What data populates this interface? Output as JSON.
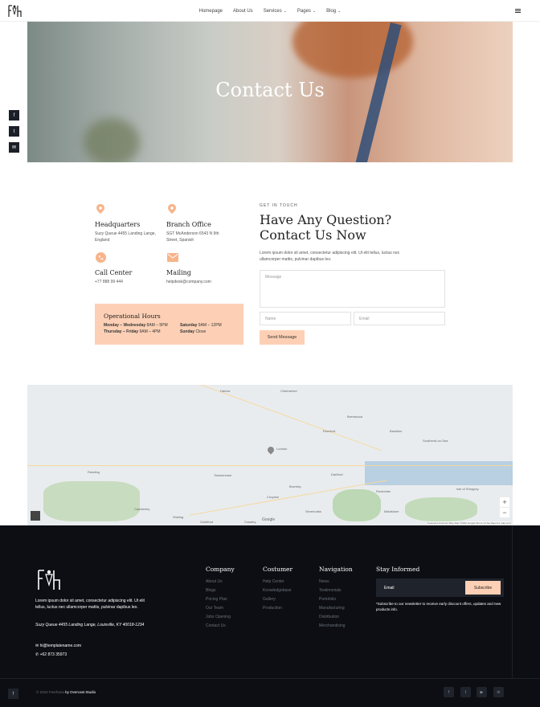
{
  "header": {
    "nav": [
      {
        "label": "Homepage",
        "dropdown": false
      },
      {
        "label": "About Us",
        "dropdown": false
      },
      {
        "label": "Services",
        "dropdown": true
      },
      {
        "label": "Pages",
        "dropdown": true
      },
      {
        "label": "Blog",
        "dropdown": true
      }
    ]
  },
  "hero": {
    "title": "Contact Us"
  },
  "side_social": [
    "facebook-icon",
    "twitter-icon",
    "email-icon"
  ],
  "contact": {
    "headquarters": {
      "title": "Headquarters",
      "text": "Suzy Queue 4455 Landing Lange, England"
    },
    "branch": {
      "title": "Branch Office",
      "text": "SGT McAnderson 6543 N 9th Street, Spanish"
    },
    "call": {
      "title": "Call Center",
      "text": "+77 888 99 444"
    },
    "mailing": {
      "title": "Mailing",
      "text": "helpdesk@company.com"
    }
  },
  "hours": {
    "title": "Operational Hours",
    "rows": [
      {
        "day": "Monday – Wednesday",
        "time": "8AM – 5PM"
      },
      {
        "day": "Saturday",
        "time": "9AM – 12PM"
      },
      {
        "day": "Thursday – Friday",
        "time": "9AM – 4PM"
      },
      {
        "day": "Sunday",
        "time": "Close"
      }
    ]
  },
  "form": {
    "eyebrow": "GET IN TOUCH",
    "heading_line1": "Have Any Question?",
    "heading_line2": "Contact Us Now",
    "intro": "Lorem ipsum dolor sit amet, consectetur adipiscing elit. Ut elit tellus, luctus nec ullamcorper mattis, pulvinar dapibus leo.",
    "message_placeholder": "Message",
    "name_placeholder": "Name",
    "email_placeholder": "Email",
    "send_label": "Send Message"
  },
  "map": {
    "labels": [
      "Harlow",
      "Chelmsford",
      "Brentwood",
      "Basildon",
      "Southend-on-Sea",
      "Romford",
      "London",
      "Dartford",
      "Reading",
      "Woking",
      "Guildford",
      "Croydon",
      "Bromley",
      "Maidstone",
      "Isle of Sheppey",
      "Twickenham",
      "Sevenoaks",
      "Rochester",
      "Crawley",
      "Camberley"
    ],
    "attribution": "Keyboard shortcuts  Map data ©2022 Google  Terms of Use  Report a map error",
    "google": "Google"
  },
  "footer": {
    "description": "Lorem ipsum dolor sit amet, consectetur adipiscing elit. Ut elit tellus, luctus nec ullamcorper mattis, pulvinar dapibus leo.",
    "address": "Suzy Queue 4455 Landing Lange, Louisville, KY 40018-1234",
    "email": "hi@templatename.com",
    "phone": "+62 873 35973",
    "columns": [
      {
        "title": "Company",
        "items": [
          "About Us",
          "Blogs",
          "Pricing Plan",
          "Our Team",
          "Jobs Opening",
          "Contact Us"
        ]
      },
      {
        "title": "Costumer",
        "items": [
          "Help Center",
          "Knowledgebase",
          "Gallery",
          "Production"
        ]
      },
      {
        "title": "Navigation",
        "items": [
          "News",
          "Testimonials",
          "Portofolio",
          "Manufacturing",
          "Distribution",
          "Merchandising"
        ]
      }
    ],
    "stay_title": "Stay Informed",
    "email_placeholder": "Email",
    "subscribe_label": "Subscribe",
    "subscribe_note": "*Subscribe to our newsletter to receive early discount offers, updates and new products info.",
    "copyright": "© 2022 Fevrhana",
    "copyright_by": "by Overcast Studio",
    "social": [
      "facebook-icon",
      "twitter-icon",
      "youtube-icon",
      "linkedin-icon"
    ]
  },
  "colors": {
    "accent": "#fdd0b5",
    "icon": "#f7b48a",
    "footer_bg": "#0c0e13"
  }
}
